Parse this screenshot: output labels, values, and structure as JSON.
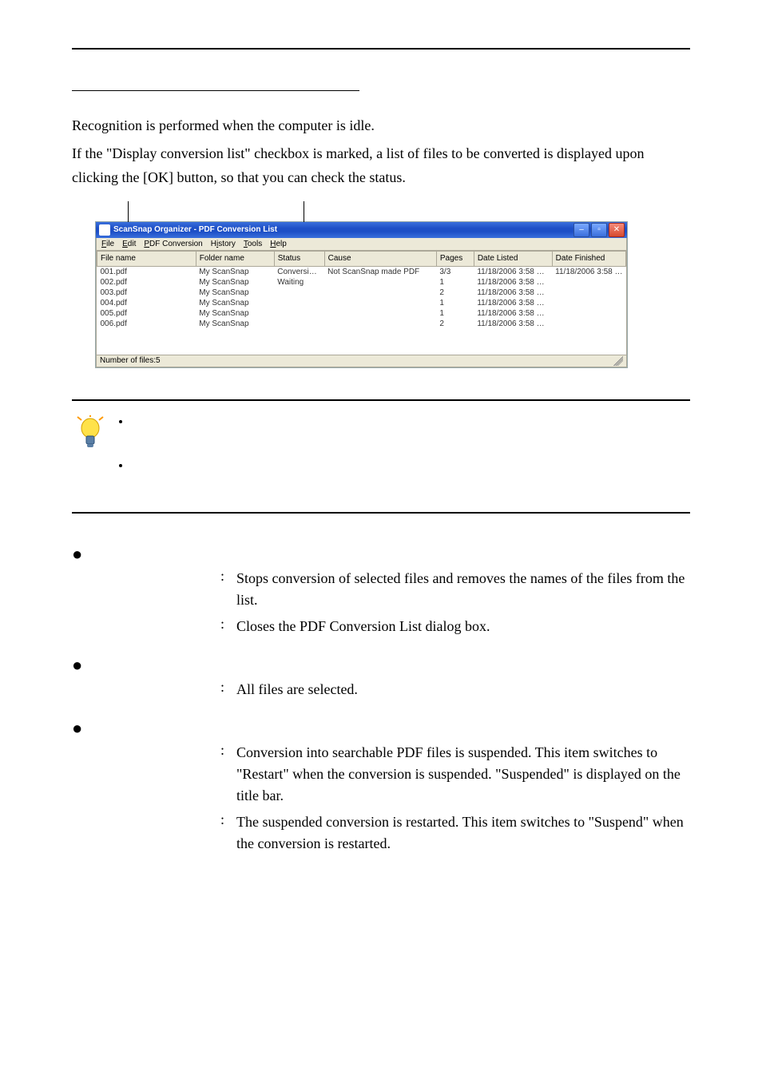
{
  "intro": {
    "line1": "Recognition is performed when the computer is idle.",
    "line2": "If the \"Display conversion list\" checkbox is marked, a list of files to be converted is displayed upon clicking the [OK] button, so that you can check the status."
  },
  "window": {
    "title": "ScanSnap Organizer - PDF Conversion List",
    "menubar": [
      "File",
      "Edit",
      "PDF Conversion",
      "History",
      "Tools",
      "Help"
    ],
    "columns": [
      "File name",
      "Folder name",
      "Status",
      "Cause",
      "Pages",
      "Date Listed",
      "Date Finished"
    ],
    "rows": [
      {
        "file": "001.pdf",
        "folder": "My ScanSnap",
        "status": "Conversi…",
        "cause": "Not ScanSnap made PDF",
        "pages": "3/3",
        "listed": "11/18/2006 3:58 …",
        "finished": "11/18/2006 3:58 …"
      },
      {
        "file": "002.pdf",
        "folder": "My ScanSnap",
        "status": "Waiting",
        "cause": "",
        "pages": "1",
        "listed": "11/18/2006 3:58 …",
        "finished": ""
      },
      {
        "file": "003.pdf",
        "folder": "My ScanSnap",
        "status": "",
        "cause": "",
        "pages": "2",
        "listed": "11/18/2006 3:58 …",
        "finished": ""
      },
      {
        "file": "004.pdf",
        "folder": "My ScanSnap",
        "status": "",
        "cause": "",
        "pages": "1",
        "listed": "11/18/2006 3:58 …",
        "finished": ""
      },
      {
        "file": "005.pdf",
        "folder": "My ScanSnap",
        "status": "",
        "cause": "",
        "pages": "1",
        "listed": "11/18/2006 3:58 …",
        "finished": ""
      },
      {
        "file": "006.pdf",
        "folder": "My ScanSnap",
        "status": "",
        "cause": "",
        "pages": "2",
        "listed": "11/18/2006 3:58 …",
        "finished": ""
      }
    ],
    "status": "Number of files:5"
  },
  "callout": {
    "b1": "",
    "b2": ""
  },
  "menus": {
    "file": {
      "head": "",
      "delete_label": "",
      "delete_desc": "Stops conversion of selected files and removes the names of the files from the list.",
      "close_label": "",
      "close_desc": "Closes the PDF Conversion List dialog box."
    },
    "edit": {
      "head": "",
      "selectall_label": "",
      "selectall_desc": "All files are selected."
    },
    "pdfconv": {
      "head": "",
      "suspend_label": "",
      "suspend_desc": "Conversion into searchable PDF files is suspended. This item switches to \"Restart\" when the conversion is suspended. \"Suspended\" is displayed on the title bar.",
      "restart_label": "",
      "restart_desc": "The suspended conversion is restarted. This item switches to \"Suspend\" when the conversion is restarted."
    }
  }
}
